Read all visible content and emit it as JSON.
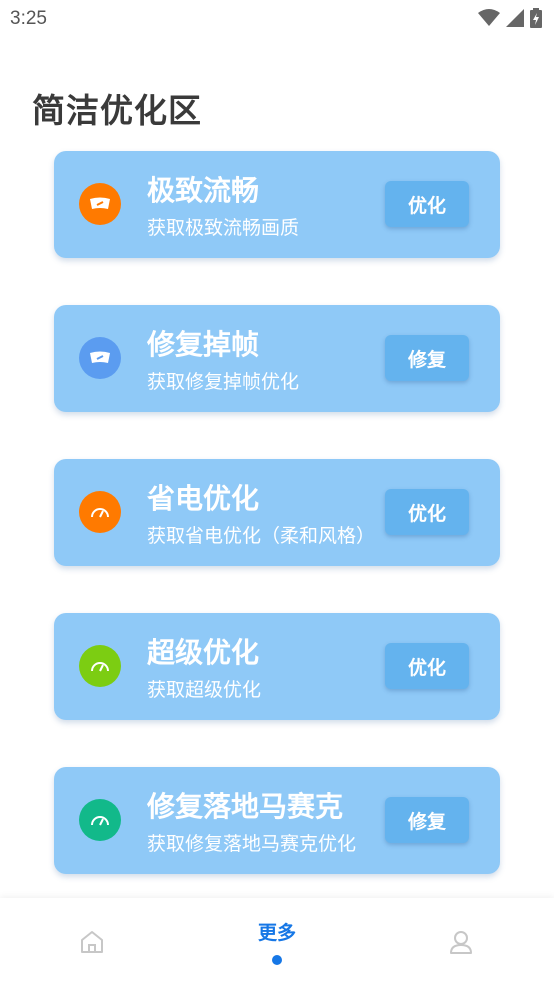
{
  "status_bar": {
    "time": "3:25",
    "icons": [
      "wifi-icon",
      "signal-icon",
      "battery-icon"
    ]
  },
  "page": {
    "section_title": "简洁优化区"
  },
  "cards": [
    {
      "title": "极致流畅",
      "subtitle": "获取极致流畅画质",
      "button": "优化",
      "icon": "speedometer-icon",
      "icon_color": "#ff7a00"
    },
    {
      "title": "修复掉帧",
      "subtitle": "获取修复掉帧优化",
      "button": "修复",
      "icon": "speedometer-icon",
      "icon_color": "#5b9cf0"
    },
    {
      "title": "省电优化",
      "subtitle": "获取省电优化（柔和风格）",
      "button": "优化",
      "icon": "gauge-icon",
      "icon_color": "#ff7a00"
    },
    {
      "title": "超级优化",
      "subtitle": "获取超级优化",
      "button": "优化",
      "icon": "gauge-icon",
      "icon_color": "#7ccd12"
    },
    {
      "title": "修复落地马赛克",
      "subtitle": "获取修复落地马赛克优化",
      "button": "修复",
      "icon": "gauge-icon",
      "icon_color": "#12b98a"
    }
  ],
  "bottom_nav": {
    "items": [
      {
        "label": "",
        "icon": "home-icon",
        "active": false
      },
      {
        "label": "更多",
        "icon": "",
        "active": true
      },
      {
        "label": "",
        "icon": "profile-icon",
        "active": false
      }
    ]
  },
  "colors": {
    "card_bg": "#8fc9f7",
    "button_bg": "#64b3ee",
    "accent": "#1677e6",
    "title_text": "#3a3a3a"
  }
}
